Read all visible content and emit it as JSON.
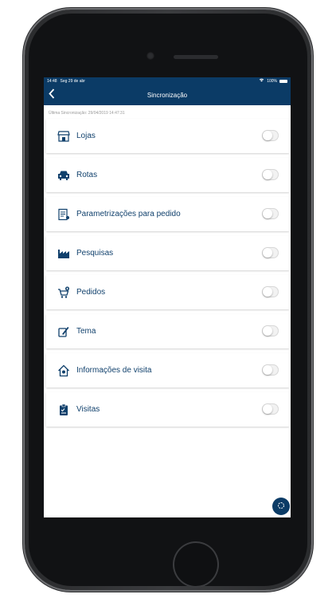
{
  "status_bar": {
    "time": "14:48",
    "date": "Seg 29 de abr",
    "battery": "100%"
  },
  "nav": {
    "title": "Sincronização"
  },
  "last_sync": "Última Sincronização: 29/04/2019 14:47:31",
  "items": [
    {
      "label": "Lojas",
      "icon": "store-icon",
      "enabled": false
    },
    {
      "label": "Rotas",
      "icon": "car-icon",
      "enabled": false
    },
    {
      "label": "Parametrizações para pedido",
      "icon": "document-settings-icon",
      "enabled": false
    },
    {
      "label": "Pesquisas",
      "icon": "factory-icon",
      "enabled": false
    },
    {
      "label": "Pedidos",
      "icon": "cart-add-icon",
      "enabled": false
    },
    {
      "label": "Tema",
      "icon": "paint-icon",
      "enabled": false
    },
    {
      "label": "Informações de visita",
      "icon": "house-info-icon",
      "enabled": false
    },
    {
      "label": "Visitas",
      "icon": "clipboard-icon",
      "enabled": false
    }
  ],
  "colors": {
    "primary": "#0b3b66",
    "text": "#10406c",
    "background": "#ffffff"
  }
}
